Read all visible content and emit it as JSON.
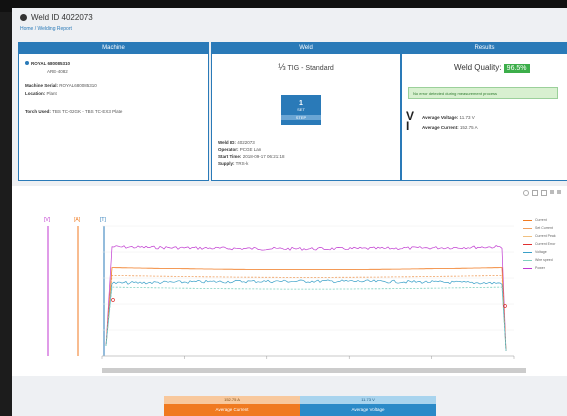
{
  "header": {
    "title": "Weld ID 4022073",
    "breadcrumb": "Home / Welding Report"
  },
  "machine": {
    "title": "Machine",
    "name": "ROYAL 680085310",
    "sub": "ARE-4082",
    "serial_label": "Machine Serial:",
    "serial": "ROYAL680085310",
    "location_label": "Location:",
    "location": "Plant",
    "tech_label": "Torch Used:",
    "tech": "TBS TC-02GK  -  TBS TC-EX3 Plate"
  },
  "weld": {
    "title": "Weld",
    "mode": "TIG - Standard",
    "button_value": "1",
    "button_unit": "SET",
    "button_label": "STEP",
    "rows": [
      {
        "label": "Weld ID:",
        "value": "4022073"
      },
      {
        "label": "Operator:",
        "value": "PCGE Lan"
      },
      {
        "label": "Start Time:",
        "value": "2018-09-17 06:21:18"
      },
      {
        "label": "Supply:",
        "value": "TRS-k"
      }
    ]
  },
  "results": {
    "title": "Results",
    "quality_label": "Weld Quality:",
    "quality_value": "96.5%",
    "quality_color": "#3cae4a",
    "alert": "No error detected during measurement process",
    "avg_voltage_label": "Average Voltage:",
    "avg_voltage": "11.73 V",
    "avg_current_label": "Average Current:",
    "avg_current": "152.75 A"
  },
  "chart_toolbar": [
    "zoom-icon",
    "pan-icon",
    "reset-icon",
    "download-icon",
    "menu-icon"
  ],
  "chart_data": {
    "type": "line",
    "xlim": [
      0,
      100
    ],
    "y_axes": [
      {
        "label": "[V]",
        "color": "#c03ad0"
      },
      {
        "label": "[A]",
        "color": "#f07a20"
      },
      {
        "label": "[T]",
        "color": "#2a7ab8"
      }
    ],
    "legend": [
      "Current",
      "Set Current",
      "Current Peak",
      "Current Error",
      "Voltage",
      "Wire speed",
      "Power"
    ],
    "series": [
      {
        "name": "Power",
        "color": "#c03ad0",
        "level": 0.84
      },
      {
        "name": "Current",
        "color": "#f07a20",
        "level": 0.68
      },
      {
        "name": "Set Current",
        "color": "#f0a060",
        "level": 0.62
      },
      {
        "name": "Voltage",
        "color": "#3aa0c8",
        "level": 0.56
      },
      {
        "name": "Wire speed",
        "color": "#7fd0c0",
        "level": 0.53
      }
    ]
  },
  "bottom": {
    "left_top": "152.75 A",
    "left_bot": "Average Current",
    "right_top": "11.73 V",
    "right_bot": "Average Voltage"
  },
  "colors": {
    "brand": "#2a7ab8",
    "orange": "#f07a20",
    "green": "#3cae4a"
  }
}
